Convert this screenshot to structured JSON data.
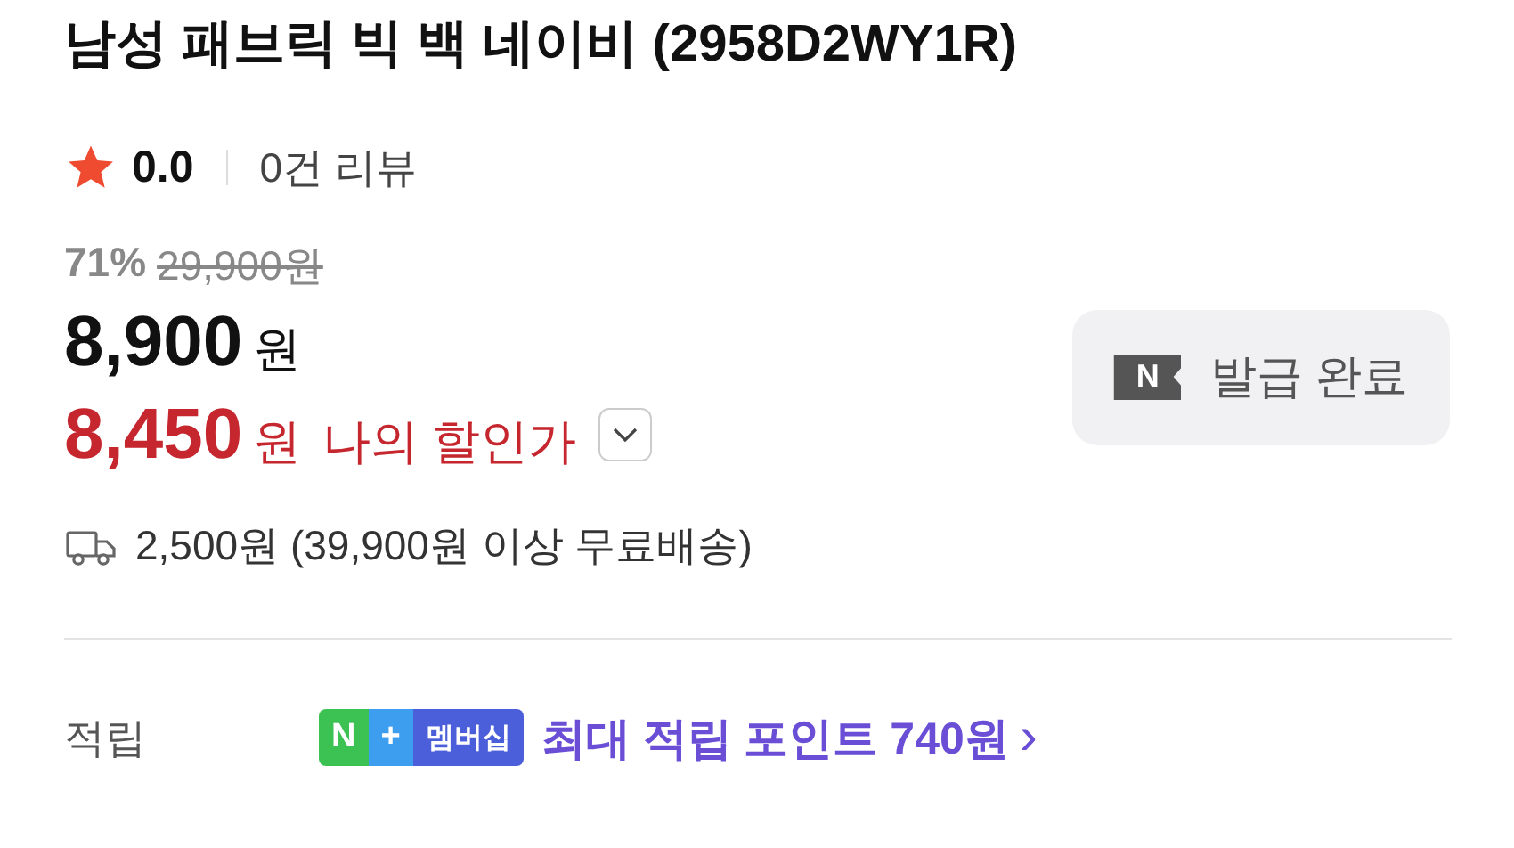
{
  "title": "남성 패브릭 빅 백 네이비 (2958D2WY1R)",
  "rating": {
    "score": "0.0",
    "reviews": "0건 리뷰"
  },
  "price": {
    "discount": "71%",
    "original": "29,900원",
    "sale": "8,900",
    "sale_unit": "원",
    "my_price": "8,450",
    "my_unit": "원",
    "my_label": "나의 할인가",
    "expanded": false
  },
  "coupon_button": {
    "icon_letter": "N",
    "label": "발급 완료"
  },
  "shipping": {
    "text": "2,500원 (39,900원 이상 무료배송)"
  },
  "points": {
    "label": "적립",
    "badge": [
      "N",
      "+",
      "멤버십"
    ],
    "text": "최대 적립 포인트 740원",
    "arrow": "›"
  }
}
